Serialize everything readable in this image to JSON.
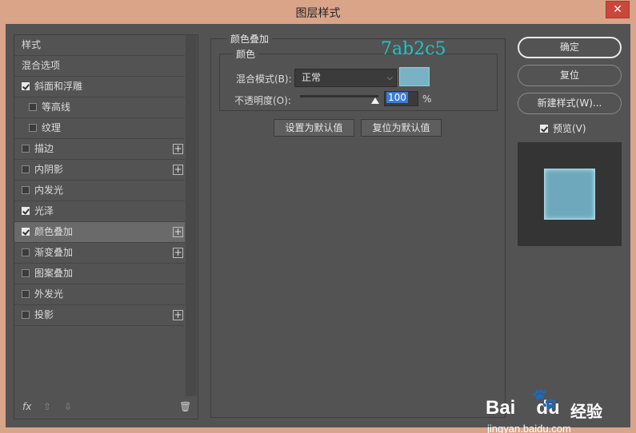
{
  "window": {
    "title": "图层样式",
    "close_glyph": "✕"
  },
  "left_panel": {
    "items": [
      {
        "label": "样式",
        "checkbox": false,
        "plus": false,
        "sub": false,
        "selected": false
      },
      {
        "label": "混合选项",
        "checkbox": false,
        "plus": false,
        "sub": false,
        "selected": false
      },
      {
        "label": "斜面和浮雕",
        "checkbox": true,
        "checked": true,
        "plus": false,
        "sub": false,
        "selected": false
      },
      {
        "label": "等高线",
        "checkbox": true,
        "checked": false,
        "plus": false,
        "sub": true,
        "selected": false
      },
      {
        "label": "纹理",
        "checkbox": true,
        "checked": false,
        "plus": false,
        "sub": true,
        "selected": false
      },
      {
        "label": "描边",
        "checkbox": true,
        "checked": false,
        "plus": true,
        "sub": false,
        "selected": false
      },
      {
        "label": "内阴影",
        "checkbox": true,
        "checked": false,
        "plus": true,
        "sub": false,
        "selected": false
      },
      {
        "label": "内发光",
        "checkbox": true,
        "checked": false,
        "plus": false,
        "sub": false,
        "selected": false
      },
      {
        "label": "光泽",
        "checkbox": true,
        "checked": true,
        "plus": false,
        "sub": false,
        "selected": false
      },
      {
        "label": "颜色叠加",
        "checkbox": true,
        "checked": true,
        "plus": true,
        "sub": false,
        "selected": true
      },
      {
        "label": "渐变叠加",
        "checkbox": true,
        "checked": false,
        "plus": true,
        "sub": false,
        "selected": false
      },
      {
        "label": "图案叠加",
        "checkbox": true,
        "checked": false,
        "plus": false,
        "sub": false,
        "selected": false
      },
      {
        "label": "外发光",
        "checkbox": true,
        "checked": false,
        "plus": false,
        "sub": false,
        "selected": false
      },
      {
        "label": "投影",
        "checkbox": true,
        "checked": false,
        "plus": true,
        "sub": false,
        "selected": false
      }
    ],
    "plus_glyph": "+",
    "footer": {
      "fx": "fx",
      "up": "⇧",
      "down": "⇩",
      "trash": "🗑"
    }
  },
  "color_overlay": {
    "group_title": "颜色叠加",
    "sub_title": "颜色",
    "hex_annotation": "7ab2c5",
    "blend_label": "混合模式(B):",
    "blend_value": "正常",
    "chevron": "⌵",
    "swatch_color": "#7ab2c5",
    "opacity_label": "不透明度(O):",
    "opacity_value": "100",
    "opacity_percent": 100,
    "percent_sign": "%",
    "set_default": "设置为默认值",
    "reset_default": "复位为默认值"
  },
  "right_panel": {
    "ok": "确定",
    "reset": "复位",
    "new_style": "新建样式(W)...",
    "preview_label": "预览(V)",
    "preview_checked": true
  },
  "watermark": {
    "bai": "Bai",
    "du": "du",
    "jingyan": "经验",
    "url": "jingyan.baidu.com"
  }
}
